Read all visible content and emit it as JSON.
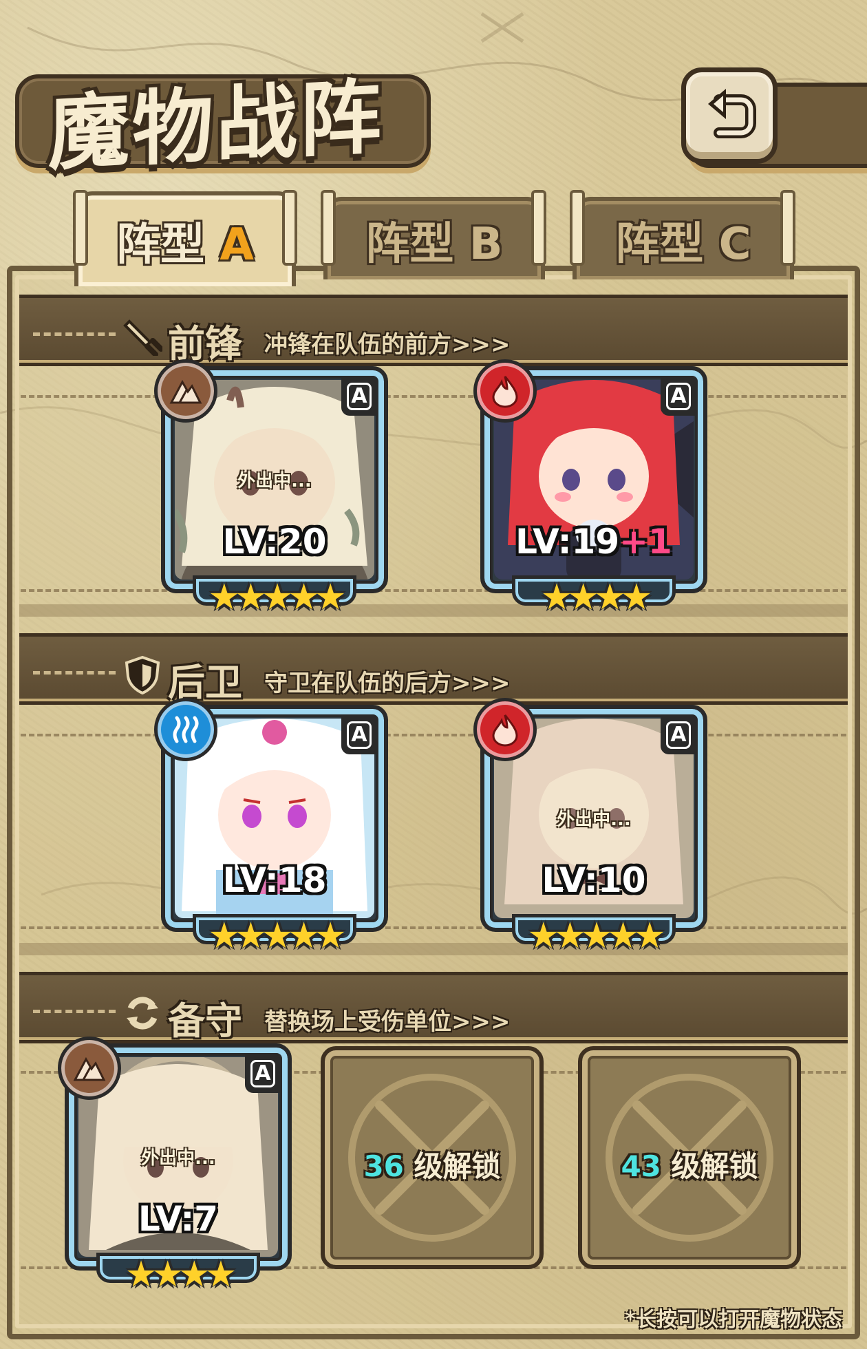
{
  "header": {
    "title": "魔物战阵",
    "back_icon": "return-arrow-icon"
  },
  "tabs": [
    {
      "label_main": "阵型",
      "label_suffix": "A",
      "active": true
    },
    {
      "label_main": "阵型",
      "label_suffix": "B",
      "active": false
    },
    {
      "label_main": "阵型",
      "label_suffix": "C",
      "active": false
    }
  ],
  "sections": {
    "front": {
      "icon": "sword-icon",
      "title": "前锋",
      "desc": "冲锋在队伍的前方>>>"
    },
    "back": {
      "icon": "shield-icon",
      "title": "后卫",
      "desc": "守卫在队伍的后方>>>"
    },
    "reserve": {
      "icon": "swap-icon",
      "title": "备守",
      "desc": "替换场上受伤单位>>>"
    }
  },
  "units": {
    "front1": {
      "element": "earth",
      "rank": "A",
      "level": "LV:20",
      "stars": 5,
      "away": true,
      "away_text": "外出中...",
      "hair": "#e9e6dc"
    },
    "front2": {
      "element": "fire",
      "rank": "A",
      "level": "LV:19",
      "level_bonus": "+1",
      "stars": 4,
      "away": false,
      "hair": "#e23a43"
    },
    "back1": {
      "element": "water",
      "rank": "A",
      "level": "LV:18",
      "stars": 5,
      "away": false,
      "hair": "#ffffff"
    },
    "back2": {
      "element": "fire",
      "rank": "A",
      "level": "LV:10",
      "stars": 5,
      "away": true,
      "away_text": "外出中...",
      "hair": "#f2c9c6"
    },
    "reserve1": {
      "element": "earth",
      "rank": "A",
      "level": "LV:7",
      "stars": 4,
      "away": true,
      "away_text": "外出中...",
      "hair": "#e7e1d4"
    }
  },
  "locked_slots": [
    {
      "level": "36",
      "text": " 级解锁"
    },
    {
      "level": "43",
      "text": " 级解锁"
    }
  ],
  "footer_hint": "*长按可以打开魔物状态",
  "colors": {
    "card_border": "#9fd7f0",
    "star": "#ffd12a",
    "accent_tab": "#f2a21c",
    "unlock_num": "#4ee3e0"
  }
}
